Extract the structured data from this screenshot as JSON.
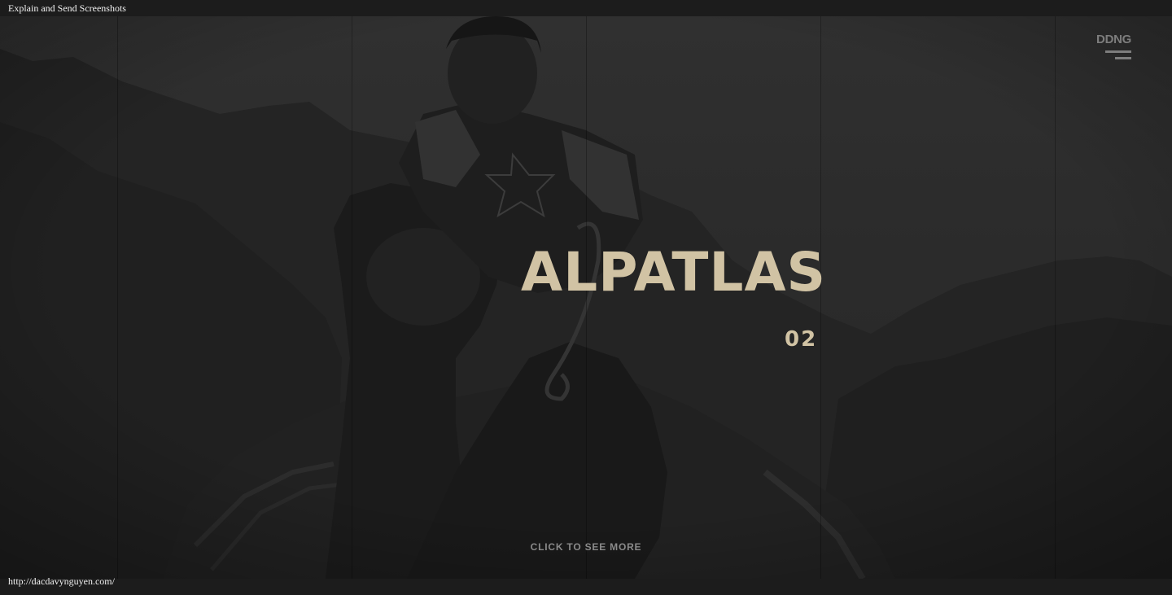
{
  "window": {
    "title": "Explain and Send Screenshots",
    "url": "http://dacdavynguyen.com/"
  },
  "header": {
    "brand": "DDNG",
    "menu_icon": "hamburger-menu-icon"
  },
  "hero": {
    "title": "ALPATLAS",
    "number": "02",
    "cta": "CLICK TO SEE MORE"
  },
  "colors": {
    "accent": "#d1c3a4",
    "muted": "#7d7d7d",
    "bar": "#1c1c1c"
  }
}
